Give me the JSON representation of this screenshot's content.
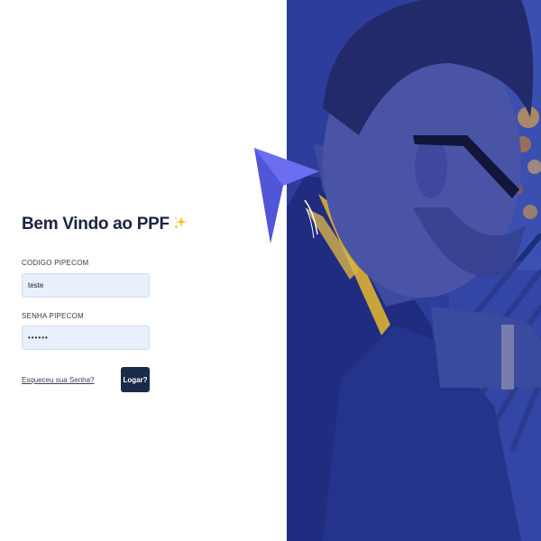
{
  "login": {
    "title": "Bem Vindo ao PPF",
    "title_icon": "sparkles-icon",
    "code_label": "CODIGO PIPECOM",
    "code_value": "teste",
    "password_label": "SENHA PIPECOM",
    "password_value": "••••••",
    "forgot_link": "Esqueceu sua Senha?",
    "submit_label": "Logar?"
  },
  "colors": {
    "title": "#1a2340",
    "input_bg": "#e8f0fe",
    "button_bg": "#1a2a4a",
    "photo_tint": "#2a3a9a",
    "arrow_accent": "#6b6ef0"
  },
  "hero": {
    "image": "person-photo-blue-tint",
    "logo_icon": "arrow-logo-icon"
  }
}
